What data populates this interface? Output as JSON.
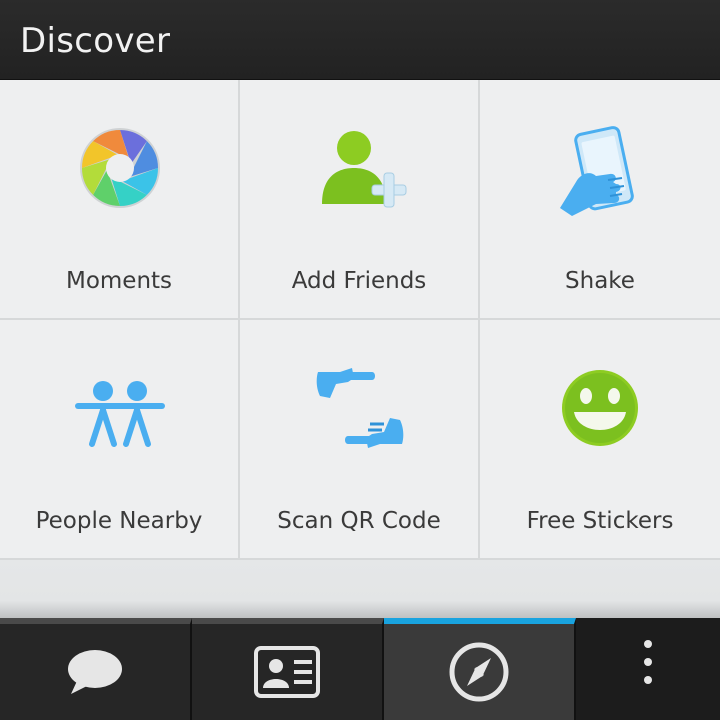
{
  "header": {
    "title": "Discover"
  },
  "tiles": [
    {
      "label": "Moments",
      "icon": "aperture-icon"
    },
    {
      "label": "Add Friends",
      "icon": "add-person-icon"
    },
    {
      "label": "Shake",
      "icon": "shake-phone-icon"
    },
    {
      "label": "People Nearby",
      "icon": "people-nearby-icon"
    },
    {
      "label": "Scan QR Code",
      "icon": "scan-hands-icon"
    },
    {
      "label": "Free Stickers",
      "icon": "smiley-icon"
    }
  ],
  "tabbar": {
    "tabs": [
      {
        "icon": "chat-bubble-icon",
        "active": false
      },
      {
        "icon": "contacts-card-icon",
        "active": false
      },
      {
        "icon": "compass-icon",
        "active": true
      }
    ],
    "overflow_icon": "more-vertical-icon"
  },
  "colors": {
    "accent": "#19a3df",
    "green": "#7cc01f",
    "blue": "#4aaef0"
  }
}
